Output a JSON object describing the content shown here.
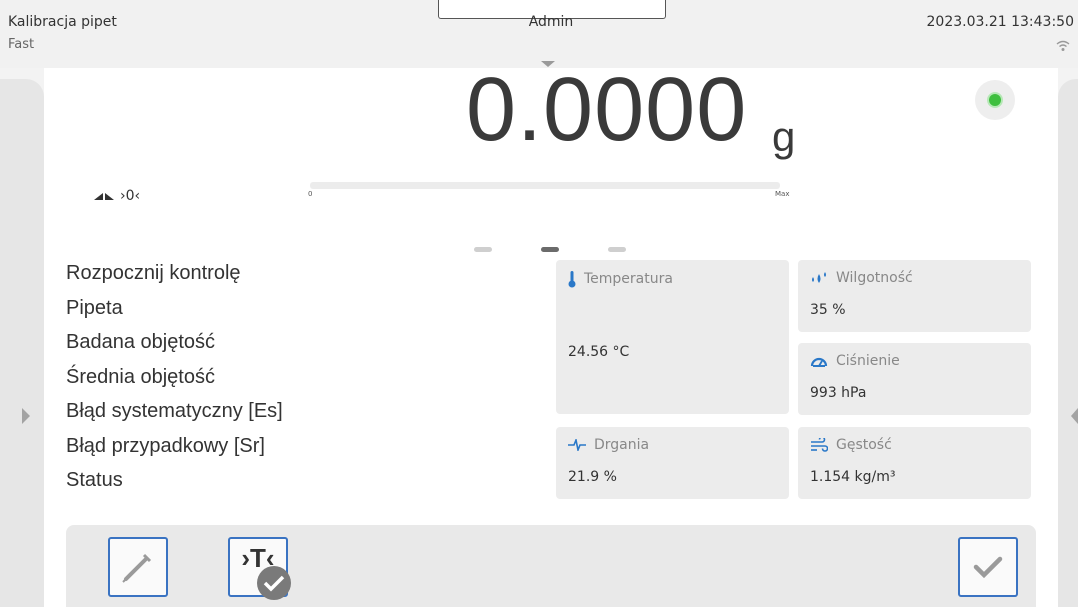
{
  "header": {
    "title": "Kalibracja pipet",
    "mode": "Fast",
    "user": "Admin",
    "datetime": "2023.03.21 13:43:50"
  },
  "display": {
    "weight_value": "0.0000",
    "unit": "g",
    "indicator_text": "›0‹",
    "bar_min_label": "0",
    "bar_max_label": "Max",
    "status_color": "#3fbf3f"
  },
  "pager": {
    "pages": 3,
    "active_page": 2
  },
  "menu": {
    "items": [
      "Rozpocznij kontrolę",
      "Pipeta",
      "Badana objętość",
      "Średnia objętość",
      "Błąd systematyczny [Es]",
      "Błąd przypadkowy [Sr]",
      "Status"
    ]
  },
  "environment": {
    "temperature": {
      "label": "Temperatura",
      "value": "24.56 °C",
      "icon": "thermometer-icon"
    },
    "humidity": {
      "label": "Wilgotność",
      "value": "35 %",
      "icon": "droplets-icon"
    },
    "pressure": {
      "label": "Ciśnienie",
      "value": "993 hPa",
      "icon": "gauge-icon"
    },
    "vibration": {
      "label": "Drgania",
      "value": "21.9 %",
      "icon": "vibration-icon"
    },
    "density": {
      "label": "Gęstość",
      "value": "1.154 kg/m³",
      "icon": "wind-icon"
    }
  },
  "toolbar": {
    "pipette_icon": "pipette-icon",
    "tare_label": "›T‹",
    "confirm_icon": "checkmark-icon"
  },
  "colors": {
    "accent": "#3a73c2",
    "icon_blue": "#2a78c8"
  }
}
